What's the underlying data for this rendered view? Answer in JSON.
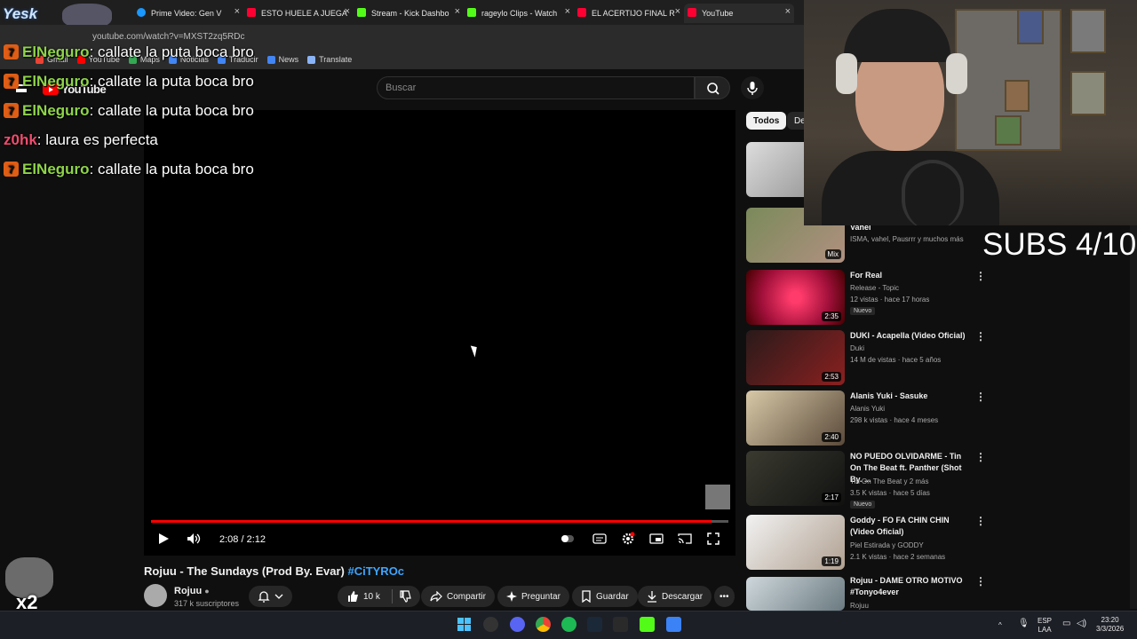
{
  "browser": {
    "tabs": [
      {
        "label": "",
        "color": "#ff4e8a"
      },
      {
        "label": "Prime Video: Gen V",
        "color": "#1a98ff"
      },
      {
        "label": "ESTO HUELE A JUEGA",
        "color": "#ff0033"
      },
      {
        "label": "Stream - Kick Dashbo",
        "color": "#53fc18"
      },
      {
        "label": "rageylo Clips - Watch",
        "color": "#53fc18"
      },
      {
        "label": "EL ACERTIJO FINAL R",
        "color": "#ff0033"
      },
      {
        "label": "YouTube",
        "color": "#ff0033"
      }
    ],
    "tab_close": "×",
    "url": "youtube.com/watch?v=MXST2zq5RDc",
    "bookmarks": [
      {
        "label": "Gmail",
        "color": "#ea4335"
      },
      {
        "label": "YouTube",
        "color": "#ff0000"
      },
      {
        "label": "Maps",
        "color": "#34a853"
      },
      {
        "label": "Noticias",
        "color": "#4285f4"
      },
      {
        "label": "Traducir",
        "color": "#4285f4"
      },
      {
        "label": "News",
        "color": "#4285f4"
      },
      {
        "label": "Translate",
        "color": "#8ab4f8"
      }
    ]
  },
  "youtube": {
    "logo_text": "YouTube",
    "search_placeholder": "Buscar"
  },
  "overlay": {
    "yesk_text": "Yesk",
    "chat": [
      {
        "badge": "7",
        "user": "ElNeguro",
        "message": ": callate la puta boca bro"
      },
      {
        "badge": "7",
        "user": "ElNeguro",
        "message": ": callate la puta boca bro"
      },
      {
        "badge": "7",
        "user": "ElNeguro",
        "message": ": callate la puta boca bro"
      },
      {
        "badge": "",
        "user": "z0hk",
        "message": ": laura es perfecta"
      },
      {
        "badge": "7",
        "user": "ElNeguro",
        "message": ": callate la puta boca bro"
      }
    ],
    "emote_multiplier": "x2",
    "subs_goal": "SUBS 4/10"
  },
  "player": {
    "time": "2:08 / 2:12",
    "progress": 0.97,
    "title": "Rojuu - The Sundays (Prod By. Evar)",
    "hashtag": "#CiTYROc",
    "channel_name": "Rojuu",
    "subscribers": "317 k suscriptores",
    "likes": "10 k",
    "share_label": "Compartir",
    "ask_label": "Preguntar",
    "save_label": "Guardar",
    "download_label": "Descargar"
  },
  "sidebar": {
    "chips": [
      "Todos",
      "De"
    ],
    "items": [
      {
        "title": "",
        "meta1": "",
        "meta2": "",
        "duration": "",
        "badge": ""
      },
      {
        "title": "Vahel",
        "meta1": "ISMA, vahel, Pausrrr y muchos más",
        "meta2": "",
        "duration": "Mix",
        "badge": ""
      },
      {
        "title": "For Real",
        "meta1": "Release - Topic",
        "meta2": "12 vistas · hace 17 horas",
        "duration": "2:35",
        "badge": "Nuevo"
      },
      {
        "title": "DUKI - Acapella (Video Oficial)",
        "meta1": "Duki",
        "meta2": "14 M de vistas · hace 5 años",
        "duration": "2:53",
        "badge": ""
      },
      {
        "title": "Alanis Yuki - Sasuke",
        "meta1": "Alanis Yuki",
        "meta2": "298 k vistas · hace 4 meses",
        "duration": "2:40",
        "badge": ""
      },
      {
        "title": "NO PUEDO OLVIDARME - Tin On The Beat ft. Panther (Shot By. ...",
        "meta1": "Tin On The Beat y 2 más",
        "meta2": "3.5 K vistas · hace 5 días",
        "duration": "2:17",
        "badge": "Nuevo"
      },
      {
        "title": "Goddy - FO FA CHIN CHIN (Video Oficial)",
        "meta1": "Piel Estirada y GODDY",
        "meta2": "2.1 K vistas · hace 2 semanas",
        "duration": "1:19",
        "badge": ""
      },
      {
        "title": "Rojuu - DAME OTRO MOTIVO #Tonyo4ever",
        "meta1": "Rojuu",
        "meta2": "",
        "duration": "",
        "badge": ""
      }
    ]
  },
  "taskbar": {
    "language": "ESP",
    "region": "LAA",
    "clock_time": "23:20",
    "clock_date": "3/3/2026"
  },
  "colors": {
    "accent": "#ff0000",
    "link": "#3ea6ff",
    "chat_user": "#8fd44a",
    "chat_user2": "#f04c6f"
  }
}
